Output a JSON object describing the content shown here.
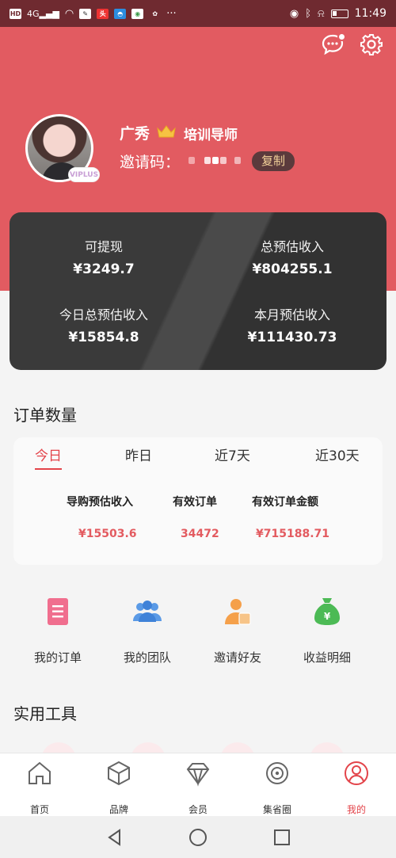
{
  "status_bar": {
    "network": "4G",
    "time": "11:49"
  },
  "profile": {
    "name": "广秀",
    "role": "培训导师",
    "invite_label": "邀请码：",
    "copy_label": "复制",
    "badge": "VIPLUS"
  },
  "earnings": [
    {
      "label": "可提现",
      "value": "¥3249.7"
    },
    {
      "label": "总预估收入",
      "value": "¥804255.1"
    },
    {
      "label": "今日总预估收入",
      "value": "¥15854.8"
    },
    {
      "label": "本月预估收入",
      "value": "¥111430.73"
    }
  ],
  "orders": {
    "title": "订单数量",
    "tabs": [
      "今日",
      "昨日",
      "近7天",
      "近30天"
    ],
    "active_tab": "今日",
    "stats": [
      {
        "label": "导购预估收入",
        "value": "¥15503.6"
      },
      {
        "label": "有效订单",
        "value": "34472"
      },
      {
        "label": "有效订单金额",
        "value": "¥715188.71"
      }
    ]
  },
  "quick_menu": [
    {
      "label": "我的订单",
      "icon": "order-list-icon"
    },
    {
      "label": "我的团队",
      "icon": "team-icon"
    },
    {
      "label": "邀请好友",
      "icon": "invite-friend-icon"
    },
    {
      "label": "收益明细",
      "icon": "money-bag-icon"
    }
  ],
  "tools": {
    "title": "实用工具"
  },
  "bottom_nav": [
    {
      "label": "首页",
      "icon": "home-icon"
    },
    {
      "label": "品牌",
      "icon": "brand-cube-icon"
    },
    {
      "label": "会员",
      "icon": "diamond-icon"
    },
    {
      "label": "集省圈",
      "icon": "circle-icon"
    },
    {
      "label": "我的",
      "icon": "profile-icon"
    }
  ],
  "colors": {
    "header_red": "#e25b61",
    "accent_red": "#e3444a",
    "card_dark": "#3a3a3a",
    "gold_text": "#f3d29a"
  }
}
